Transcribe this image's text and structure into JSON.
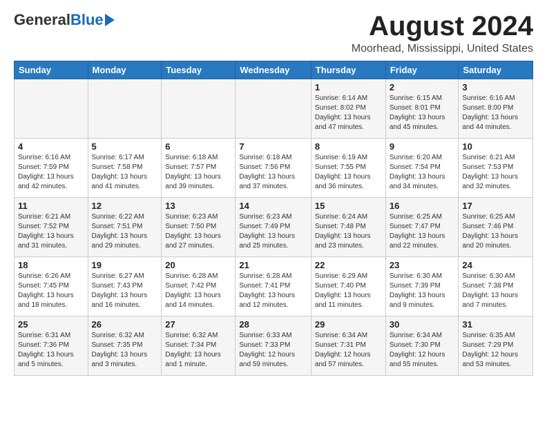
{
  "header": {
    "logo_general": "General",
    "logo_blue": "Blue",
    "month_year": "August 2024",
    "location": "Moorhead, Mississippi, United States"
  },
  "calendar": {
    "days_of_week": [
      "Sunday",
      "Monday",
      "Tuesday",
      "Wednesday",
      "Thursday",
      "Friday",
      "Saturday"
    ],
    "weeks": [
      [
        {
          "day": "",
          "info": ""
        },
        {
          "day": "",
          "info": ""
        },
        {
          "day": "",
          "info": ""
        },
        {
          "day": "",
          "info": ""
        },
        {
          "day": "1",
          "info": "Sunrise: 6:14 AM\nSunset: 8:02 PM\nDaylight: 13 hours\nand 47 minutes."
        },
        {
          "day": "2",
          "info": "Sunrise: 6:15 AM\nSunset: 8:01 PM\nDaylight: 13 hours\nand 45 minutes."
        },
        {
          "day": "3",
          "info": "Sunrise: 6:16 AM\nSunset: 8:00 PM\nDaylight: 13 hours\nand 44 minutes."
        }
      ],
      [
        {
          "day": "4",
          "info": "Sunrise: 6:16 AM\nSunset: 7:59 PM\nDaylight: 13 hours\nand 42 minutes."
        },
        {
          "day": "5",
          "info": "Sunrise: 6:17 AM\nSunset: 7:58 PM\nDaylight: 13 hours\nand 41 minutes."
        },
        {
          "day": "6",
          "info": "Sunrise: 6:18 AM\nSunset: 7:57 PM\nDaylight: 13 hours\nand 39 minutes."
        },
        {
          "day": "7",
          "info": "Sunrise: 6:18 AM\nSunset: 7:56 PM\nDaylight: 13 hours\nand 37 minutes."
        },
        {
          "day": "8",
          "info": "Sunrise: 6:19 AM\nSunset: 7:55 PM\nDaylight: 13 hours\nand 36 minutes."
        },
        {
          "day": "9",
          "info": "Sunrise: 6:20 AM\nSunset: 7:54 PM\nDaylight: 13 hours\nand 34 minutes."
        },
        {
          "day": "10",
          "info": "Sunrise: 6:21 AM\nSunset: 7:53 PM\nDaylight: 13 hours\nand 32 minutes."
        }
      ],
      [
        {
          "day": "11",
          "info": "Sunrise: 6:21 AM\nSunset: 7:52 PM\nDaylight: 13 hours\nand 31 minutes."
        },
        {
          "day": "12",
          "info": "Sunrise: 6:22 AM\nSunset: 7:51 PM\nDaylight: 13 hours\nand 29 minutes."
        },
        {
          "day": "13",
          "info": "Sunrise: 6:23 AM\nSunset: 7:50 PM\nDaylight: 13 hours\nand 27 minutes."
        },
        {
          "day": "14",
          "info": "Sunrise: 6:23 AM\nSunset: 7:49 PM\nDaylight: 13 hours\nand 25 minutes."
        },
        {
          "day": "15",
          "info": "Sunrise: 6:24 AM\nSunset: 7:48 PM\nDaylight: 13 hours\nand 23 minutes."
        },
        {
          "day": "16",
          "info": "Sunrise: 6:25 AM\nSunset: 7:47 PM\nDaylight: 13 hours\nand 22 minutes."
        },
        {
          "day": "17",
          "info": "Sunrise: 6:25 AM\nSunset: 7:46 PM\nDaylight: 13 hours\nand 20 minutes."
        }
      ],
      [
        {
          "day": "18",
          "info": "Sunrise: 6:26 AM\nSunset: 7:45 PM\nDaylight: 13 hours\nand 18 minutes."
        },
        {
          "day": "19",
          "info": "Sunrise: 6:27 AM\nSunset: 7:43 PM\nDaylight: 13 hours\nand 16 minutes."
        },
        {
          "day": "20",
          "info": "Sunrise: 6:28 AM\nSunset: 7:42 PM\nDaylight: 13 hours\nand 14 minutes."
        },
        {
          "day": "21",
          "info": "Sunrise: 6:28 AM\nSunset: 7:41 PM\nDaylight: 13 hours\nand 12 minutes."
        },
        {
          "day": "22",
          "info": "Sunrise: 6:29 AM\nSunset: 7:40 PM\nDaylight: 13 hours\nand 11 minutes."
        },
        {
          "day": "23",
          "info": "Sunrise: 6:30 AM\nSunset: 7:39 PM\nDaylight: 13 hours\nand 9 minutes."
        },
        {
          "day": "24",
          "info": "Sunrise: 6:30 AM\nSunset: 7:38 PM\nDaylight: 13 hours\nand 7 minutes."
        }
      ],
      [
        {
          "day": "25",
          "info": "Sunrise: 6:31 AM\nSunset: 7:36 PM\nDaylight: 13 hours\nand 5 minutes."
        },
        {
          "day": "26",
          "info": "Sunrise: 6:32 AM\nSunset: 7:35 PM\nDaylight: 13 hours\nand 3 minutes."
        },
        {
          "day": "27",
          "info": "Sunrise: 6:32 AM\nSunset: 7:34 PM\nDaylight: 13 hours\nand 1 minute."
        },
        {
          "day": "28",
          "info": "Sunrise: 6:33 AM\nSunset: 7:33 PM\nDaylight: 12 hours\nand 59 minutes."
        },
        {
          "day": "29",
          "info": "Sunrise: 6:34 AM\nSunset: 7:31 PM\nDaylight: 12 hours\nand 57 minutes."
        },
        {
          "day": "30",
          "info": "Sunrise: 6:34 AM\nSunset: 7:30 PM\nDaylight: 12 hours\nand 55 minutes."
        },
        {
          "day": "31",
          "info": "Sunrise: 6:35 AM\nSunset: 7:29 PM\nDaylight: 12 hours\nand 53 minutes."
        }
      ]
    ]
  }
}
